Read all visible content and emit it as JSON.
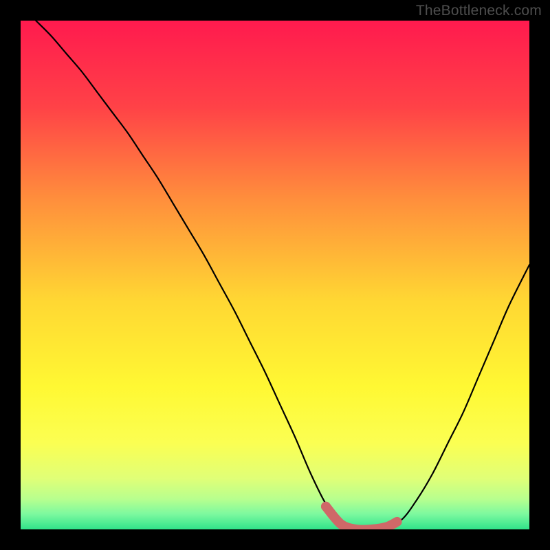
{
  "watermark": "TheBottleneck.com",
  "chart_data": {
    "type": "line",
    "title": "",
    "xlabel": "",
    "ylabel": "",
    "xlim": [
      0,
      100
    ],
    "ylim": [
      0,
      100
    ],
    "grid": false,
    "series": [
      {
        "name": "bottleneck-curve",
        "x": [
          3,
          6,
          9,
          12,
          15,
          18,
          21,
          24,
          27,
          30,
          33,
          36,
          39,
          42,
          45,
          48,
          51,
          54,
          57,
          60,
          63,
          66,
          69,
          72,
          75,
          78,
          81,
          84,
          87,
          90,
          93,
          96,
          100
        ],
        "y": [
          100,
          97,
          93.5,
          90,
          86,
          82,
          78,
          73.5,
          69,
          64,
          59,
          54,
          48.5,
          43,
          37,
          31,
          24.5,
          18,
          11,
          5,
          1,
          0,
          0,
          0.5,
          2,
          6,
          11,
          17,
          23,
          30,
          37,
          44,
          52
        ],
        "color": "#000000"
      },
      {
        "name": "optimal-zone",
        "x": [
          60,
          63,
          66,
          69,
          72,
          74
        ],
        "y": [
          4.5,
          1,
          0,
          0,
          0.5,
          1.5
        ],
        "color": "#cf6868"
      }
    ],
    "gradient_stops": [
      {
        "offset": 0,
        "color": "#ff1a4e"
      },
      {
        "offset": 17,
        "color": "#ff4247"
      },
      {
        "offset": 35,
        "color": "#ff8e3c"
      },
      {
        "offset": 55,
        "color": "#ffd733"
      },
      {
        "offset": 72,
        "color": "#fff833"
      },
      {
        "offset": 83,
        "color": "#fbff52"
      },
      {
        "offset": 90,
        "color": "#e0ff77"
      },
      {
        "offset": 94,
        "color": "#b8ff8e"
      },
      {
        "offset": 97,
        "color": "#7cf99f"
      },
      {
        "offset": 100,
        "color": "#30e28a"
      }
    ]
  }
}
